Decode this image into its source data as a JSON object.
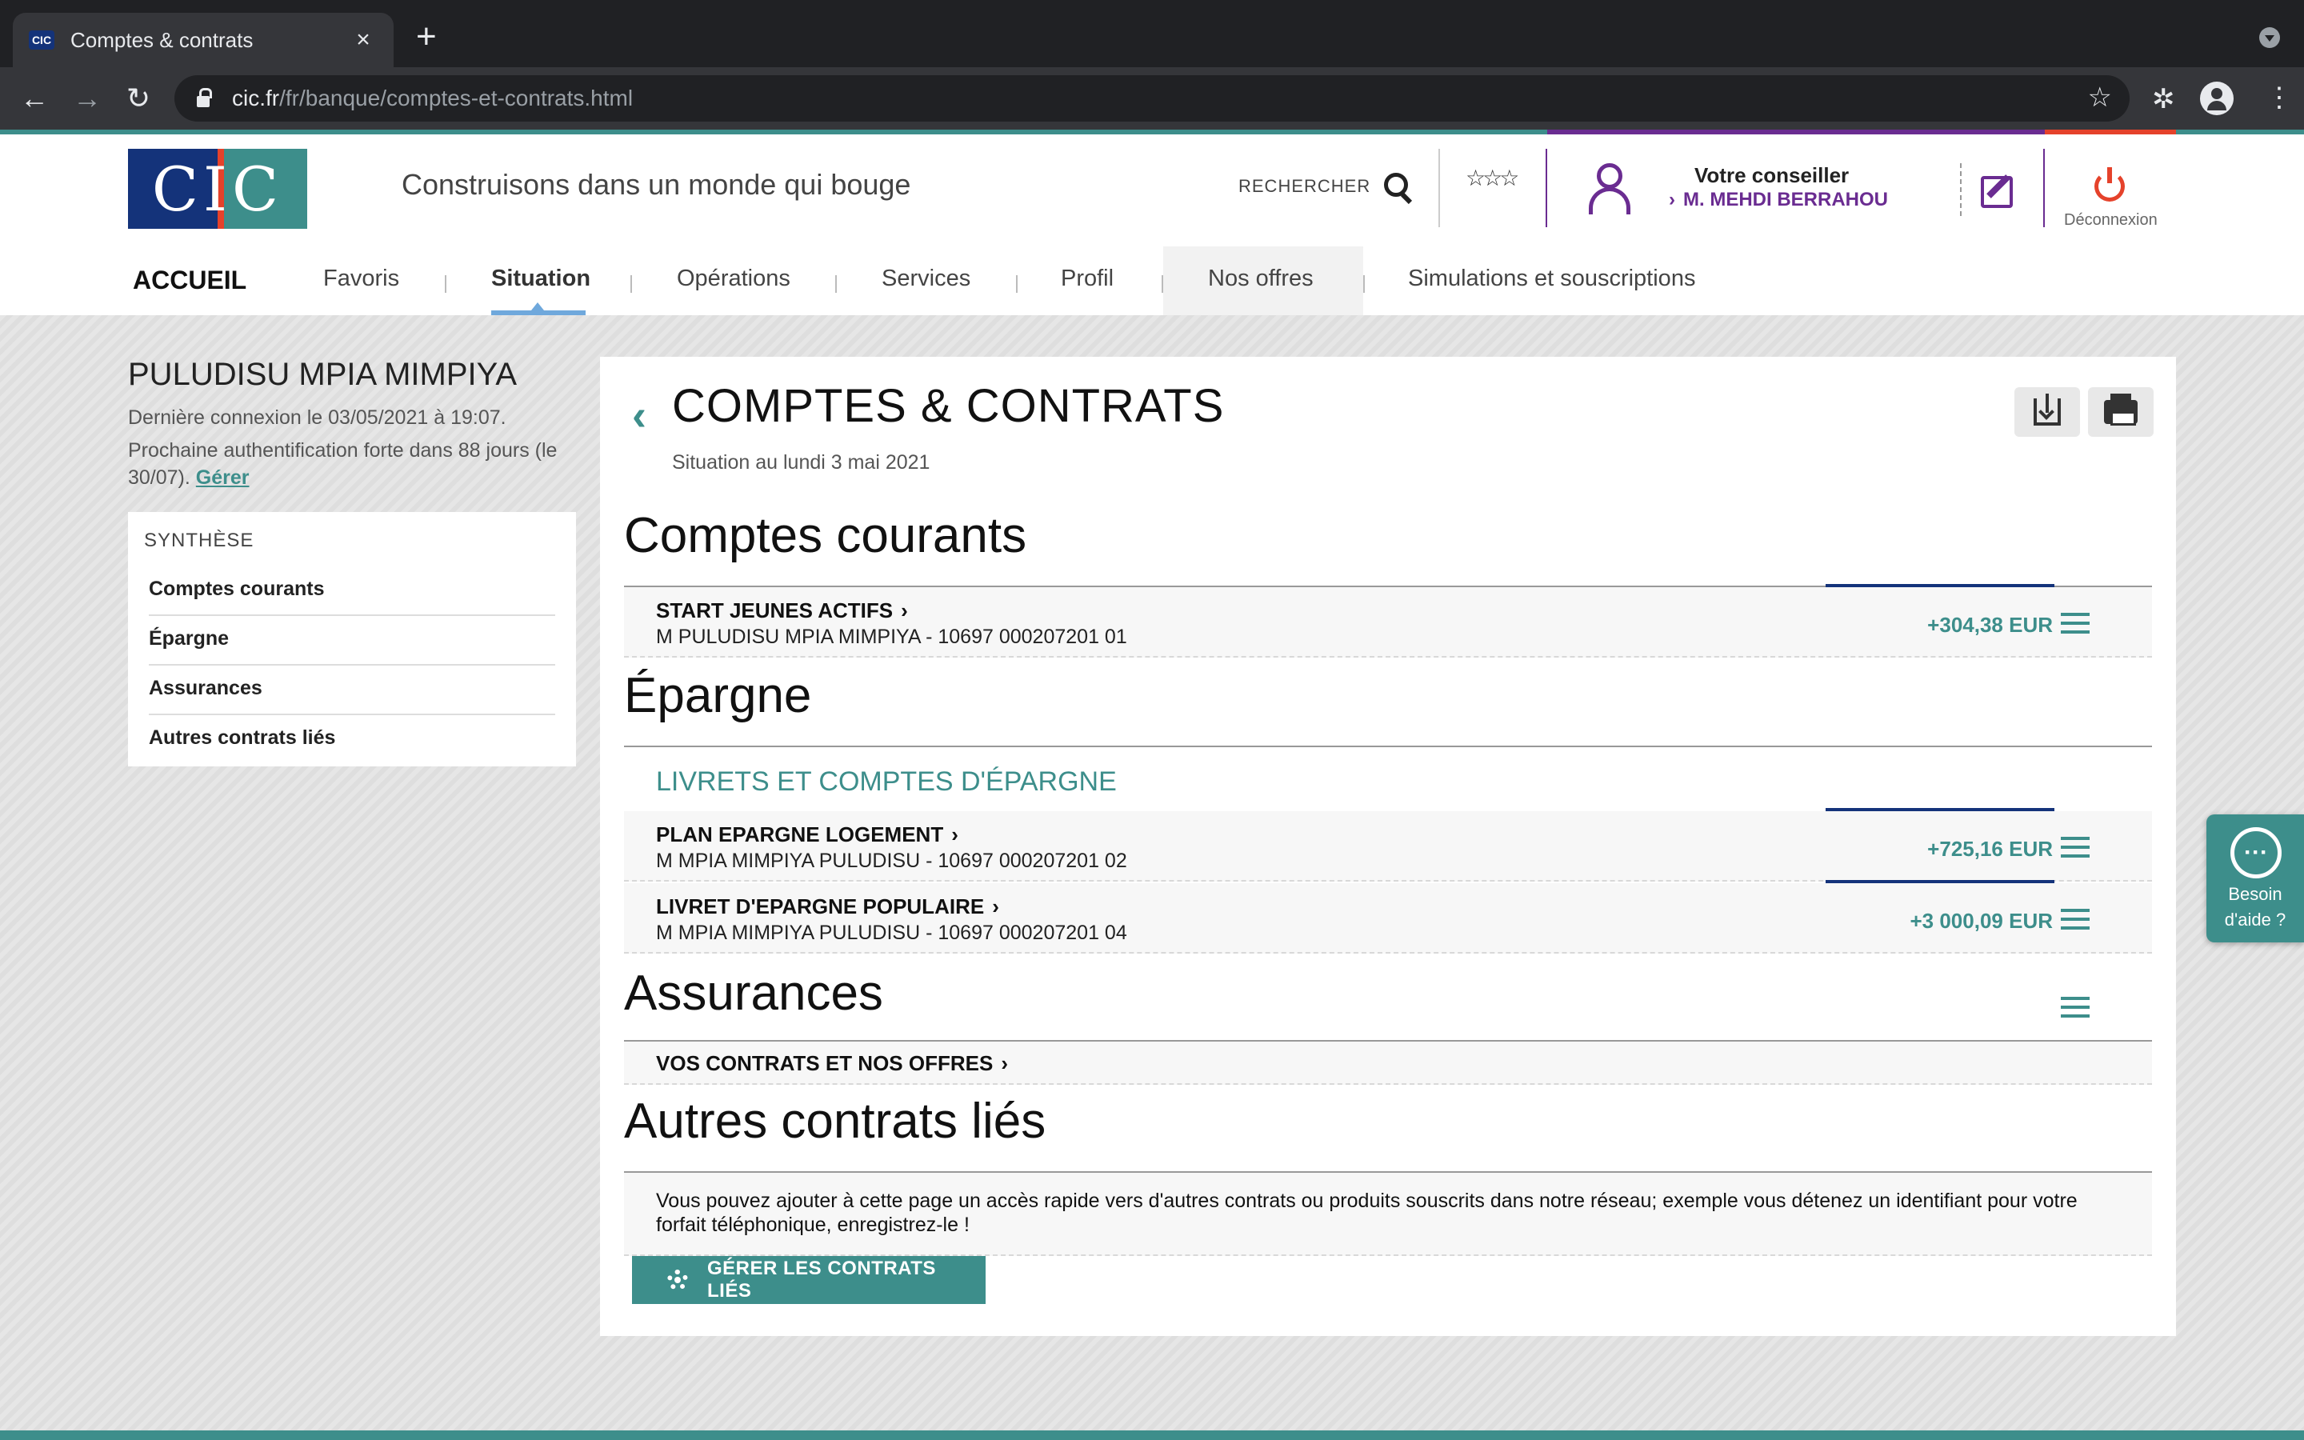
{
  "browser": {
    "tab_title": "Comptes & contrats",
    "tab_favicon": "CIC",
    "url_host": "cic.fr",
    "url_path": "/fr/banque/comptes-et-contrats.html"
  },
  "header": {
    "logo_text": "CIC",
    "tagline": "Construisons dans un monde qui bouge",
    "search_label": "RECHERCHER",
    "advisor_title": "Votre conseiller",
    "advisor_name": "M. MEHDI BERRAHOU",
    "logout_label": "Déconnexion"
  },
  "nav": {
    "home": "ACCUEIL",
    "items": [
      "Favoris",
      "Situation",
      "Opérations",
      "Services",
      "Profil",
      "Nos offres",
      "Simulations et souscriptions"
    ],
    "active": "Situation"
  },
  "user": {
    "name": "PULUDISU MPIA MIMPIYA",
    "last_login": "Dernière connexion le 03/05/2021 à 19:07.",
    "auth_text": "Prochaine authentification forte dans 88 jours (le 30/07).",
    "auth_link": "Gérer"
  },
  "sidebar": {
    "title": "SYNTHÈSE",
    "items": [
      "Comptes courants",
      "Épargne",
      "Assurances",
      "Autres contrats liés"
    ]
  },
  "main": {
    "title": "COMPTES & CONTRATS",
    "date": "Situation au lundi 3 mai 2021",
    "sections": {
      "current": {
        "heading": "Comptes courants",
        "accounts": [
          {
            "name": "START JEUNES ACTIFS",
            "number": "M PULUDISU MPIA MIMPIYA - 10697 000207201 01",
            "amount": "+304,38 EUR"
          }
        ]
      },
      "savings": {
        "heading": "Épargne",
        "subheading": "LIVRETS ET COMPTES D'ÉPARGNE",
        "accounts": [
          {
            "name": "PLAN EPARGNE LOGEMENT",
            "number": "M MPIA MIMPIYA PULUDISU - 10697 000207201 02",
            "amount": "+725,16 EUR"
          },
          {
            "name": "LIVRET D'EPARGNE POPULAIRE",
            "number": "M MPIA MIMPIYA PULUDISU - 10697 000207201 04",
            "amount": "+3 000,09 EUR"
          }
        ]
      },
      "insurance": {
        "heading": "Assurances",
        "link": "VOS CONTRATS ET NOS OFFRES"
      },
      "other": {
        "heading": "Autres contrats liés",
        "text": "Vous pouvez ajouter à cette page un accès rapide vers d'autres contrats ou produits souscrits dans notre réseau; exemple vous détenez un identifiant pour votre forfait téléphonique, enregistrez-le !",
        "button": "GÉRER LES CONTRATS LIÉS"
      }
    }
  },
  "help": {
    "line1": "Besoin",
    "line2": "d'aide ?"
  },
  "colors": {
    "teal": "#3d8e8b",
    "navy": "#14337a",
    "purple": "#6a2c91",
    "red": "#e5422b"
  }
}
